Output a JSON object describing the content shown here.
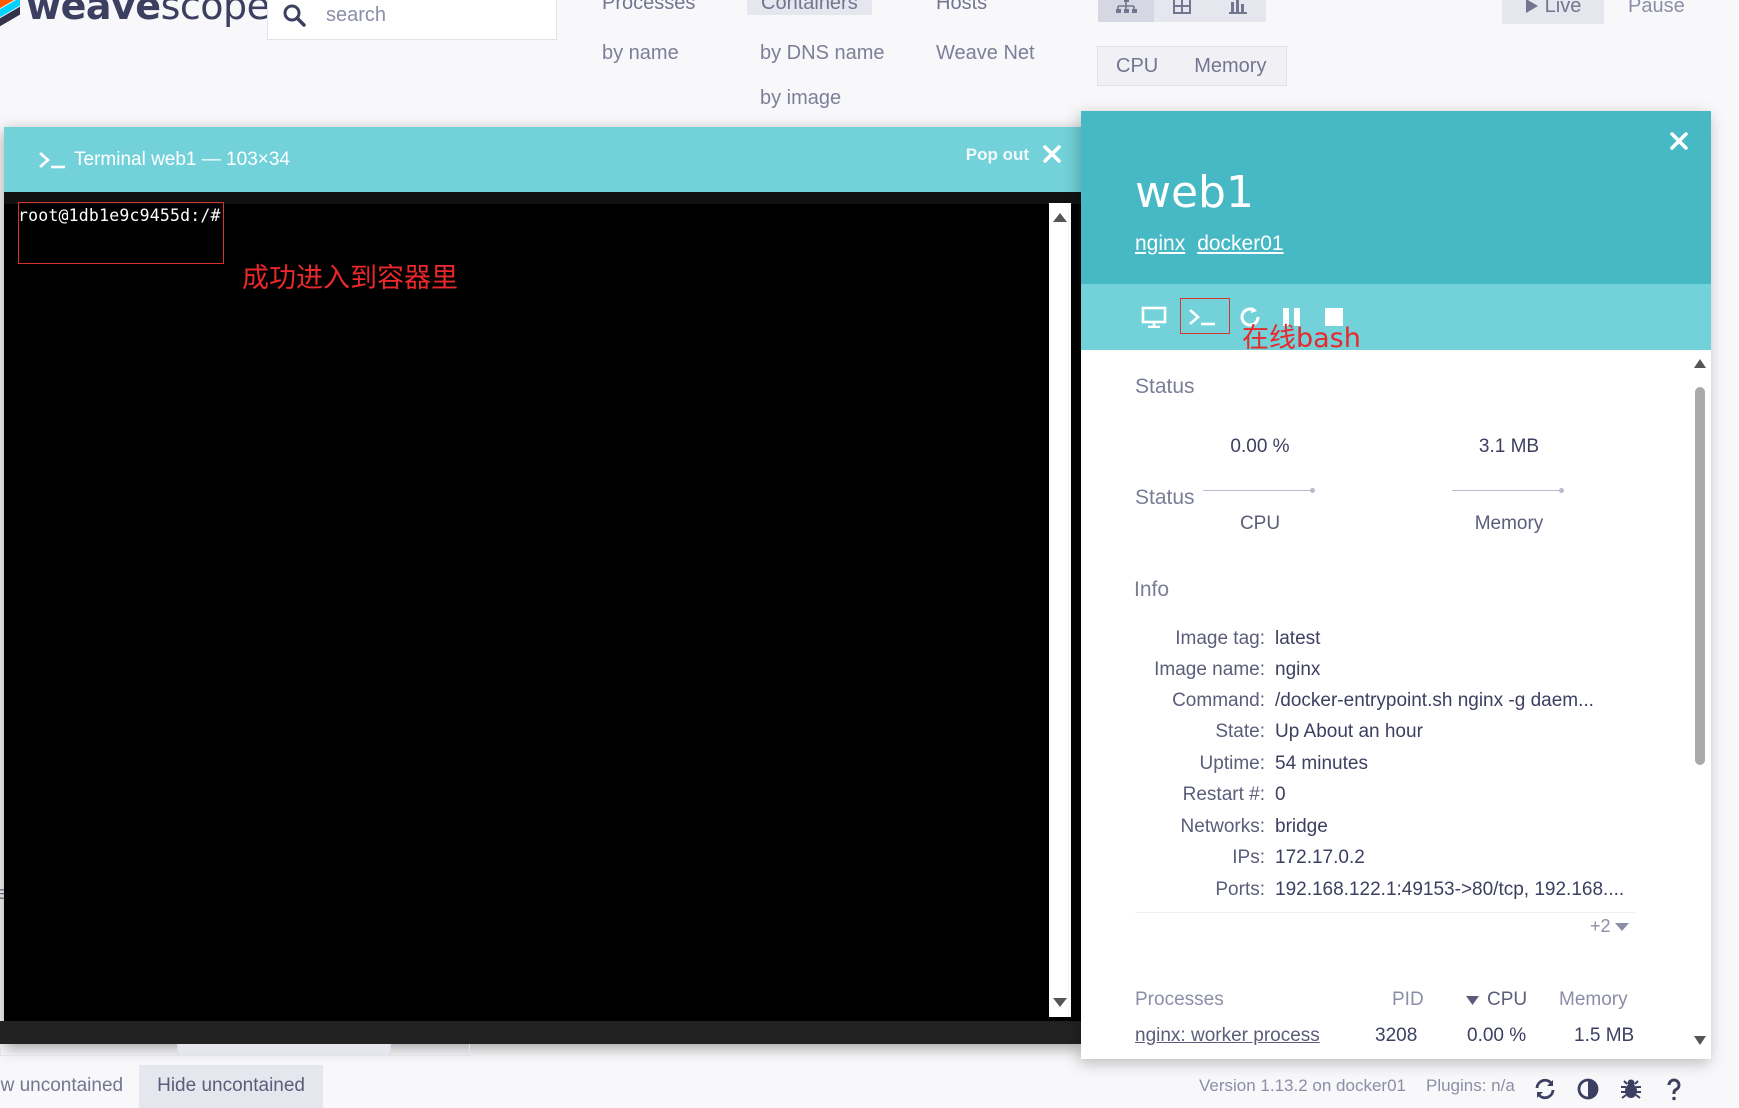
{
  "brand": {
    "name_bold": "weave",
    "name_rest": "scope"
  },
  "search": {
    "placeholder": "search"
  },
  "topologies": {
    "processes": {
      "label": "Processes",
      "sub": [
        "by name"
      ]
    },
    "containers": {
      "label": "Containers",
      "sub": [
        "by DNS name",
        "by image"
      ]
    },
    "hosts": {
      "label": "Hosts",
      "sub": [
        "Weave Net"
      ]
    }
  },
  "view_modes": [
    "graph-icon",
    "table-icon",
    "resources-icon"
  ],
  "metric_selector": [
    "CPU",
    "Memory"
  ],
  "time_controls": {
    "live": "Live",
    "pause": "Pause"
  },
  "terminal": {
    "title": "Terminal web1 — 103×34",
    "popout": "Pop out",
    "prompt": "root@1db1e9c9455d:/#",
    "annotation": "成功进入到容器里"
  },
  "details": {
    "title": "web1",
    "relatives": [
      "nginx",
      "docker01"
    ],
    "controls": [
      "monitor-icon",
      "terminal-icon",
      "restart-icon",
      "pause-icon",
      "stop-icon"
    ],
    "annotation": "在线bash",
    "status_label": "Status",
    "metrics": [
      {
        "value": "0.00 %",
        "label": "CPU"
      },
      {
        "value": "3.1 MB",
        "label": "Memory"
      }
    ],
    "info_label": "Info",
    "info": [
      {
        "key": "Image tag:",
        "value": "latest"
      },
      {
        "key": "Image name:",
        "value": "nginx"
      },
      {
        "key": "Command:",
        "value": "/docker-entrypoint.sh nginx -g daem..."
      },
      {
        "key": "State:",
        "value": "Up About an hour"
      },
      {
        "key": "Uptime:",
        "value": "54 minutes"
      },
      {
        "key": "Restart #:",
        "value": "0"
      },
      {
        "key": "Networks:",
        "value": "bridge"
      },
      {
        "key": "IPs:",
        "value": "172.17.0.2"
      },
      {
        "key": "Ports:",
        "value": "192.168.122.1:49153->80/tcp, 192.168...."
      }
    ],
    "more": "+2",
    "processes": {
      "headers": {
        "name": "Processes",
        "pid": "PID",
        "cpu": "CPU",
        "memory": "Memory"
      },
      "rows": [
        {
          "name": "nginx: worker process",
          "pid": "3208",
          "cpu": "0.00 %",
          "memory": "1.5 MB"
        }
      ]
    }
  },
  "footer": {
    "show_uncontained": "ow uncontained",
    "hide_uncontained": "Hide uncontained",
    "version": "Version 1.13.2 on docker01",
    "plugins": "Plugins: n/a",
    "icons": [
      "refresh-icon",
      "contrast-icon",
      "bug-icon",
      "help-icon"
    ]
  },
  "colors": {
    "header_teal": "#46b9c5",
    "controls_teal": "#73d1da",
    "annotation_red": "#e8292b",
    "text_dark": "#3c3f60"
  }
}
